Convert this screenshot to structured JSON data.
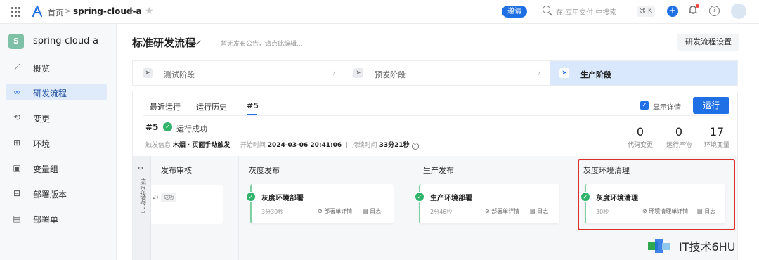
{
  "topbar": {
    "breadcrumb_home": "首页",
    "breadcrumb_sep": ">",
    "project": "spring-cloud-a",
    "invite_label": "邀请",
    "search_placeholder": "在 应用交付 中搜索",
    "shortcut": "⌘ K",
    "accent": "#1f6fe5"
  },
  "sidebar": {
    "project_badge": "S",
    "project_name": "spring-cloud-a",
    "items": [
      {
        "label": "概览",
        "icon": "chart-line-icon"
      },
      {
        "label": "研发流程",
        "icon": "infinity-icon",
        "active": true
      },
      {
        "label": "变更",
        "icon": "change-icon"
      },
      {
        "label": "环境",
        "icon": "environment-icon"
      },
      {
        "label": "变量组",
        "icon": "variable-icon"
      },
      {
        "label": "部署版本",
        "icon": "package-icon"
      },
      {
        "label": "部署单",
        "icon": "document-icon"
      }
    ]
  },
  "header": {
    "title": "标准研发流程",
    "notice": "暂无发布公告，请点此编辑...",
    "settings_label": "研发流程设置"
  },
  "stages": [
    {
      "label": "测试阶段"
    },
    {
      "label": "预发阶段"
    },
    {
      "label": "生产阶段",
      "active": true
    }
  ],
  "run": {
    "tabs": [
      "最近运行",
      "运行历史",
      "#5"
    ],
    "show_detail_label": "显示详情",
    "run_button": "运行",
    "id": "#5",
    "status": "运行成功",
    "trigger_key": "触发信息",
    "trigger_user": "木烟",
    "trigger_desc": "· 页面手动触发",
    "start_key": "开始时间",
    "start_time": "2024-03-06 20:41:06",
    "duration_key": "持续时间",
    "duration": "33分21秒",
    "stats": [
      {
        "value": "0",
        "label": "代码变更"
      },
      {
        "value": "0",
        "label": "运行产物"
      },
      {
        "value": "17",
        "label": "环境变量"
      }
    ]
  },
  "pipeline": {
    "side_label": "流水线源：1",
    "columns": [
      {
        "title": "发布审核",
        "partial_num": "2)",
        "tag": "成功"
      },
      {
        "title": "灰度发布",
        "card_title": "灰度环境部署",
        "duration": "3分30秒",
        "link1": "部署单详情",
        "link2": "日志"
      },
      {
        "title": "生产发布",
        "card_title": "生产环境部署",
        "duration": "2分46秒",
        "link1": "部署单详情",
        "link2": "日志"
      },
      {
        "title": "灰度环境清理",
        "card_title": "灰度环境清理",
        "duration": "30秒",
        "link1": "环境清理单详情",
        "link2": "日志"
      }
    ]
  },
  "watermark": {
    "text": "IT技术6HU"
  }
}
